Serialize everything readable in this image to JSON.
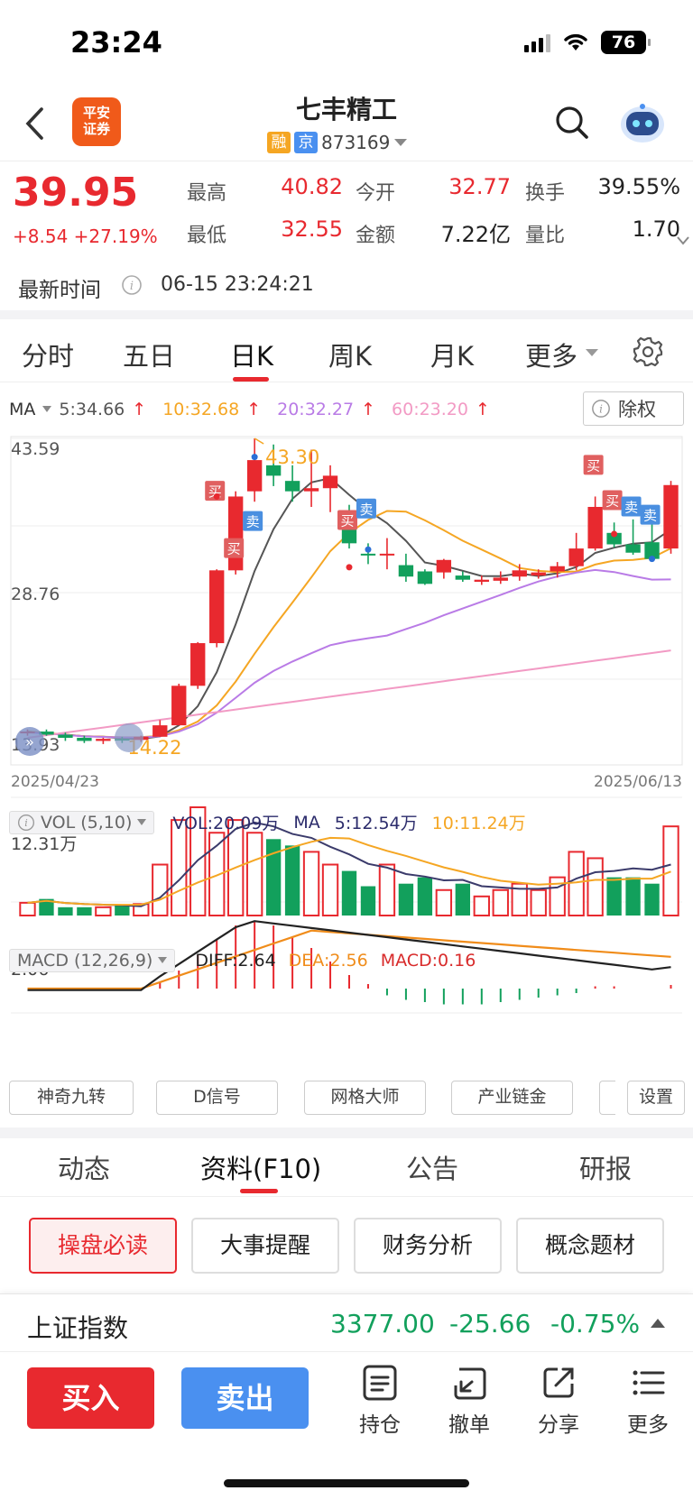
{
  "status_bar": {
    "time": "23:24",
    "battery": "76"
  },
  "header": {
    "back_icon": "chevron-left-icon",
    "logo_text": "平安证券",
    "title": "七丰精工",
    "tag_margin": "融",
    "tag_exchange": "京",
    "code": "873169",
    "search_icon": "search-icon",
    "assistant_icon": "robot-icon"
  },
  "quote": {
    "price": "39.95",
    "change": "+8.54",
    "change_pct": "+27.19%",
    "high_label": "最高",
    "high": "40.82",
    "open_label": "今开",
    "open": "32.77",
    "turnover_label": "换手",
    "turnover": "39.55%",
    "low_label": "最低",
    "low": "32.55",
    "amount_label": "金额",
    "amount": "7.22亿",
    "vol_ratio_label": "量比",
    "vol_ratio": "1.70",
    "time_label": "最新时间",
    "time": "06-15 23:24:21"
  },
  "period_tabs": [
    "分时",
    "五日",
    "日K",
    "周K",
    "月K",
    "更多"
  ],
  "active_period": "日K",
  "ma_legend": {
    "label": "MA",
    "ma5": "5:34.66",
    "ma10": "10:32.68",
    "ma20": "20:32.27",
    "ma60": "60:23.20",
    "adjust_label": "除权"
  },
  "chart_data": {
    "type": "candlestick",
    "date_start": "2025/04/23",
    "date_end": "2025/06/13",
    "y_ticks": [
      "43.59",
      "28.76"
    ],
    "y_bottom_label": "13.93",
    "max_label": "43.30",
    "min_label": "14.22",
    "ohlc": [
      [
        15.3,
        15.6,
        15.0,
        15.4
      ],
      [
        15.4,
        15.6,
        15.0,
        15.1
      ],
      [
        15.1,
        15.3,
        14.5,
        14.8
      ],
      [
        14.8,
        15.0,
        14.3,
        14.5
      ],
      [
        14.5,
        14.8,
        14.2,
        14.7
      ],
      [
        14.7,
        14.9,
        14.3,
        14.6
      ],
      [
        14.6,
        15.0,
        14.4,
        14.9
      ],
      [
        14.9,
        16.5,
        14.9,
        16.0
      ],
      [
        16.0,
        20.0,
        16.0,
        19.8
      ],
      [
        19.8,
        24.0,
        19.5,
        23.9
      ],
      [
        23.9,
        31.0,
        23.5,
        30.9
      ],
      [
        30.9,
        38.5,
        30.5,
        38.0
      ],
      [
        38.5,
        43.59,
        37.5,
        41.5
      ],
      [
        41.0,
        43.0,
        39.0,
        40.0
      ],
      [
        39.5,
        41.0,
        37.5,
        38.5
      ],
      [
        38.5,
        42.5,
        37.0,
        38.8
      ],
      [
        38.8,
        41.0,
        36.5,
        40.0
      ],
      [
        36.5,
        37.2,
        33.0,
        33.5
      ],
      [
        32.5,
        33.5,
        31.5,
        32.4
      ],
      [
        32.4,
        34.0,
        31.0,
        32.5
      ],
      [
        31.4,
        32.5,
        29.8,
        30.3
      ],
      [
        30.8,
        31.0,
        29.5,
        29.6
      ],
      [
        30.7,
        32.0,
        30.1,
        31.9
      ],
      [
        30.4,
        30.8,
        29.8,
        30.0
      ],
      [
        29.8,
        30.4,
        29.5,
        30.0
      ],
      [
        29.9,
        30.8,
        29.6,
        30.2
      ],
      [
        30.3,
        31.5,
        29.9,
        30.9
      ],
      [
        30.4,
        31.0,
        30.1,
        30.7
      ],
      [
        30.8,
        31.7,
        30.2,
        31.3
      ],
      [
        31.3,
        34.5,
        30.9,
        33.0
      ],
      [
        33.0,
        38.0,
        32.8,
        37.0
      ],
      [
        34.5,
        35.5,
        33.1,
        33.4
      ],
      [
        33.4,
        35.8,
        32.4,
        32.6
      ],
      [
        33.6,
        35.5,
        32.3,
        32.0
      ],
      [
        33.0,
        39.5,
        32.5,
        39.1
      ]
    ],
    "signals": {
      "buy_label": "买",
      "sell_label": "卖"
    },
    "volume": {
      "label": "VOL (5,10)",
      "vol_value": "VOL:20.09万",
      "ma_label": "MA",
      "ma5": "5:12.54万",
      "ma10": "10:11.24万",
      "y_tick": "12.31万",
      "bars": [
        2,
        2.6,
        1.3,
        1.3,
        1.3,
        1.6,
        1.8,
        8,
        15,
        17,
        13,
        15,
        13,
        12,
        11,
        10,
        8,
        7,
        4.6,
        8,
        5,
        6,
        4,
        5,
        3,
        4,
        5,
        4,
        6,
        10,
        9,
        6,
        6,
        5,
        14
      ]
    },
    "macd": {
      "label": "MACD (12,26,9)",
      "diff": "DIFF:2.64",
      "dea": "DEA:2.56",
      "macd": "MACD:0.16",
      "y_tick": "2.06",
      "bars": [
        0,
        0,
        0,
        0,
        0,
        0,
        0,
        0.3,
        0.8,
        1.5,
        2.2,
        2.8,
        3.0,
        2.8,
        2.3,
        1.8,
        1.2,
        0.6,
        0.2,
        -0.3,
        -0.5,
        -0.6,
        -0.7,
        -0.7,
        -0.7,
        -0.6,
        -0.5,
        -0.4,
        -0.3,
        -0.2,
        0.1,
        0.1,
        0.0,
        0.0,
        0.16
      ]
    }
  },
  "indicator_tools": [
    "神奇九转",
    "D信号",
    "网格大师",
    "产业链金"
  ],
  "settings_label": "设置",
  "section_tabs": [
    "动态",
    "资料(F10)",
    "公告",
    "研报"
  ],
  "f10_buttons": [
    "操盘必读",
    "大事提醒",
    "财务分析",
    "概念题材"
  ],
  "index_bar": {
    "name": "上证指数",
    "value": "3377.00",
    "change": "-25.66",
    "change_pct": "-0.75%"
  },
  "bottom_bar": {
    "buy": "买入",
    "sell": "卖出",
    "position": "持仓",
    "cancel": "撤单",
    "share": "分享",
    "more": "更多"
  },
  "colors": {
    "up": "#e8292f",
    "down": "#12a05c",
    "ma5": "#555555",
    "ma10": "#f5a623",
    "ma20": "#b97be6",
    "ma60": "#f29ac4",
    "accent_blue": "#4a90f0"
  }
}
